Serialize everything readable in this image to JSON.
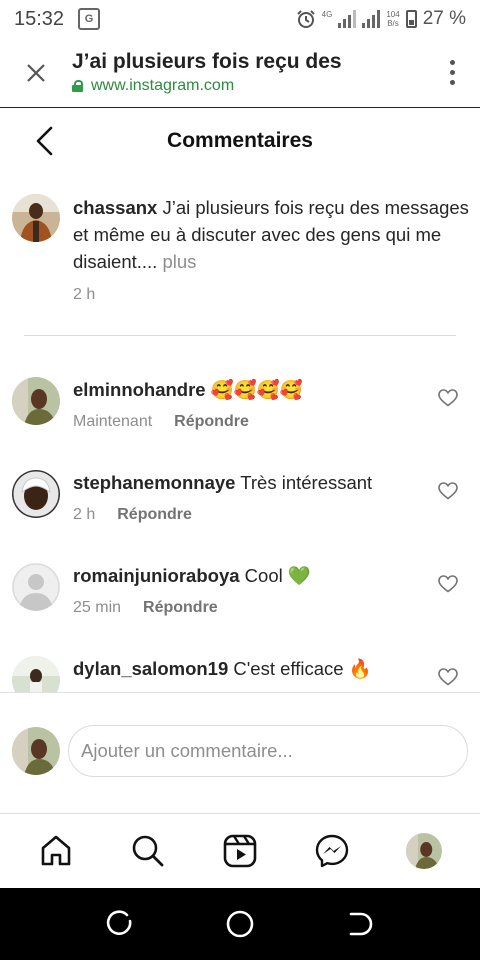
{
  "status_bar": {
    "time": "15:32",
    "network": "4G",
    "speed_value": "104",
    "speed_unit": "B/s",
    "battery": "27 %"
  },
  "browser": {
    "title": "J’ai plusieurs fois reçu des",
    "url": "www.instagram.com"
  },
  "header": {
    "title": "Commentaires"
  },
  "caption": {
    "username": "chassanx",
    "text": "J’ai plusieurs fois reçu des messages et même eu à discuter avec des gens qui me disaient....",
    "more": "plus",
    "time": "2 h"
  },
  "comments": [
    {
      "username": "elminnohandre",
      "text": "🥰🥰🥰🥰",
      "time": "Maintenant",
      "reply": "Répondre"
    },
    {
      "username": "stephanemonnaye",
      "text": "Très intéressant",
      "time": "2 h",
      "reply": "Répondre"
    },
    {
      "username": "romainjunioraboya",
      "text": "Cool 💚",
      "time": "25 min",
      "reply": "Répondre"
    },
    {
      "username": "dylan_salomon19",
      "text": "C'est efficace 🔥",
      "time": "",
      "reply": ""
    }
  ],
  "composer": {
    "placeholder": "Ajouter un commentaire..."
  },
  "icons": {
    "accent_green": "#2e8b3e",
    "heart": "heart-outline-icon",
    "nav": [
      "home-icon",
      "search-icon",
      "reels-icon",
      "messenger-icon",
      "profile-avatar"
    ]
  }
}
